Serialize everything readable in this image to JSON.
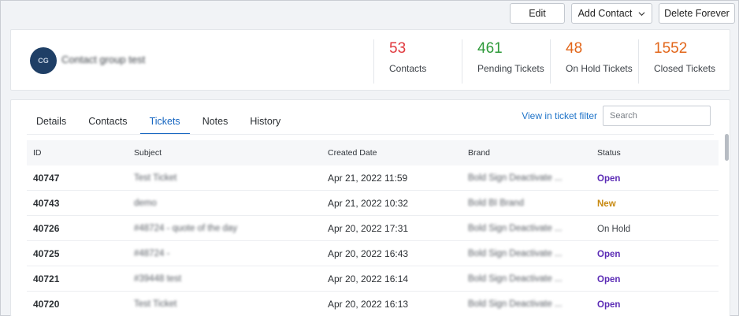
{
  "actions": {
    "edit_label": "Edit",
    "add_contact_label": "Add Contact",
    "delete_label": "Delete Forever"
  },
  "summary": {
    "avatar_initials": "CG",
    "group_name": "Contact group test",
    "stats": [
      {
        "value": "53",
        "label": "Contacts",
        "color": "#e0393e"
      },
      {
        "value": "461",
        "label": "Pending Tickets",
        "color": "#2e9a3a"
      },
      {
        "value": "48",
        "label": "On Hold Tickets",
        "color": "#e2661a"
      },
      {
        "value": "1552",
        "label": "Closed Tickets",
        "color": "#e2661a"
      }
    ]
  },
  "tabs": [
    {
      "label": "Details"
    },
    {
      "label": "Contacts"
    },
    {
      "label": "Tickets"
    },
    {
      "label": "Notes"
    },
    {
      "label": "History"
    }
  ],
  "active_tab": "Tickets",
  "view_link": "View in ticket filter",
  "search": {
    "placeholder": "Search",
    "value": ""
  },
  "table": {
    "columns": [
      "ID",
      "Subject",
      "Created Date",
      "Brand",
      "Status"
    ],
    "rows": [
      {
        "id": "40747",
        "subject": "Test Ticket",
        "date": "Apr 21, 2022 11:59",
        "brand": "Bold Sign Deactivate ...",
        "status": "Open",
        "status_class": "st-open"
      },
      {
        "id": "40743",
        "subject": "demo",
        "date": "Apr 21, 2022 10:32",
        "brand": "Bold BI Brand",
        "status": "New",
        "status_class": "st-new"
      },
      {
        "id": "40726",
        "subject": "#48724 - quote of the day",
        "date": "Apr 20, 2022 17:31",
        "brand": "Bold Sign Deactivate ...",
        "status": "On Hold",
        "status_class": "st-hold"
      },
      {
        "id": "40725",
        "subject": "#48724 -",
        "date": "Apr 20, 2022 16:43",
        "brand": "Bold Sign Deactivate ...",
        "status": "Open",
        "status_class": "st-open"
      },
      {
        "id": "40721",
        "subject": "#39448 test",
        "date": "Apr 20, 2022 16:14",
        "brand": "Bold Sign Deactivate ...",
        "status": "Open",
        "status_class": "st-open"
      },
      {
        "id": "40720",
        "subject": "Test Ticket",
        "date": "Apr 20, 2022 16:13",
        "brand": "Bold Sign Deactivate ...",
        "status": "Open",
        "status_class": "st-open"
      }
    ]
  }
}
